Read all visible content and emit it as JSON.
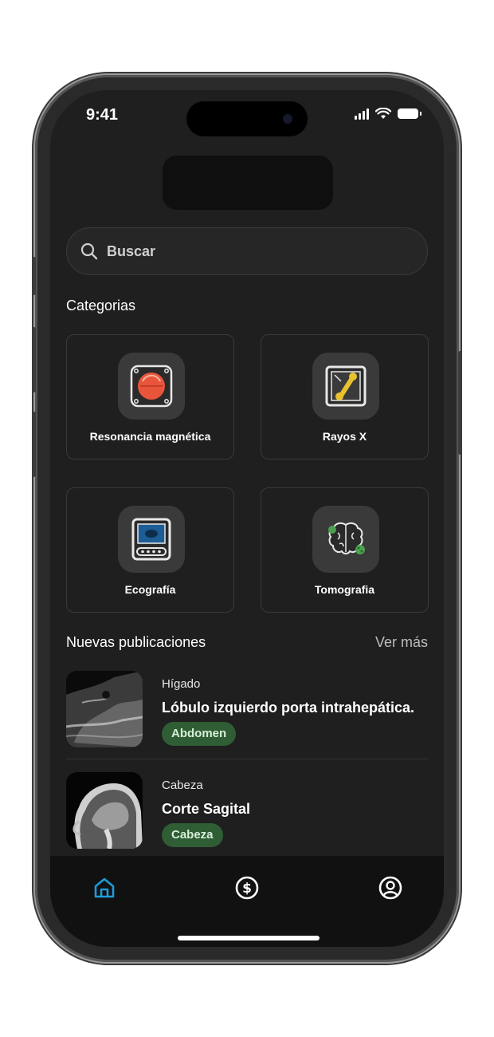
{
  "status_bar": {
    "time": "9:41"
  },
  "search": {
    "placeholder": "Buscar",
    "icon": "search-icon"
  },
  "categories": {
    "title": "Categorias",
    "items": [
      {
        "label": "Resonancia magnética",
        "icon": "mri-icon"
      },
      {
        "label": "Rayos X",
        "icon": "xray-icon"
      },
      {
        "label": "Ecografía",
        "icon": "ultrasound-icon"
      },
      {
        "label": "Tomografia",
        "icon": "brain-icon"
      }
    ]
  },
  "publications": {
    "title": "Nuevas publicaciones",
    "see_more": "Ver más",
    "items": [
      {
        "category": "Hígado",
        "title": "Lóbulo izquierdo porta intrahepática.",
        "tag": "Abdomen"
      },
      {
        "category": "Cabeza",
        "title": "Corte Sagital",
        "tag": "Cabeza"
      }
    ]
  },
  "tab_bar": {
    "items": [
      {
        "icon": "home-icon",
        "active": true
      },
      {
        "icon": "dollar-icon",
        "active": false
      },
      {
        "icon": "profile-icon",
        "active": false
      }
    ]
  },
  "colors": {
    "accent": "#1e9bd7",
    "tag_bg": "#2f5d34",
    "background": "#1f1f1f"
  }
}
